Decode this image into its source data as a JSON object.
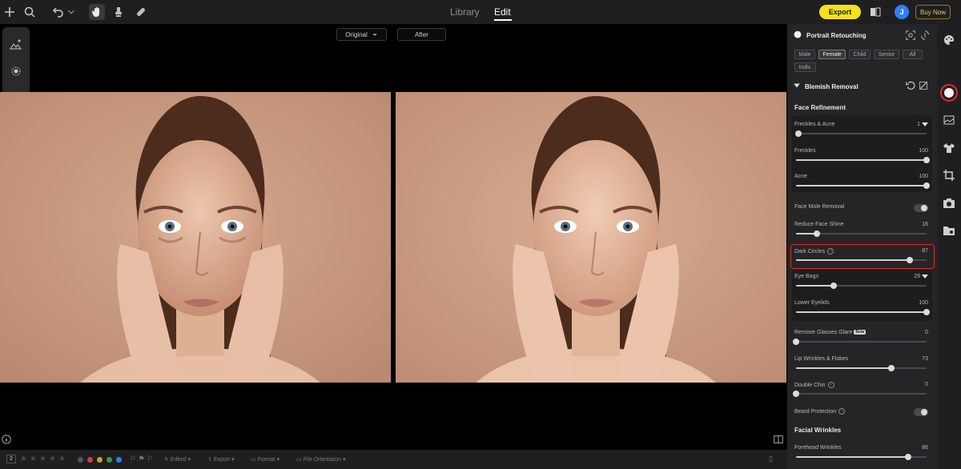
{
  "topbar": {
    "tabs": [
      "Library",
      "Edit"
    ],
    "active_tab": "Edit",
    "export_label": "Export",
    "user_initial": "J",
    "buy_label": "Buy Now"
  },
  "canvas": {
    "compare_mode": "Original",
    "after_label": "After"
  },
  "bottombar": {
    "rating_count": "2",
    "items": [
      "Edited",
      "Export",
      "Format",
      "File Orientation"
    ],
    "color_labels": [
      "#555559",
      "#d33b3b",
      "#c9a227",
      "#3a9a4a",
      "#2f7ff0"
    ]
  },
  "panel": {
    "title": "Portrait Retouching",
    "chips": [
      "Male",
      "Female",
      "Child",
      "Senior",
      "All",
      "Indiv."
    ],
    "selected_chip": "Female",
    "section": "Blemish Removal",
    "face_refinement": "Face Refinement",
    "facial_wrinkles": "Facial Wrinkles",
    "sliders": [
      {
        "label": "Freckles & Acne",
        "value": "1",
        "level": 0.02,
        "caret": true,
        "info": false
      },
      {
        "label": "Freckles",
        "value": "100",
        "level": 1.0,
        "caret": false,
        "info": false
      },
      {
        "label": "Acne",
        "value": "100",
        "level": 1.0,
        "caret": false,
        "info": false
      },
      {
        "label": "Reduce Face Shine",
        "value": "16",
        "level": 0.16,
        "caret": false,
        "info": false
      },
      {
        "label": "Dark Circles",
        "value": "87",
        "level": 0.87,
        "caret": false,
        "info": true
      },
      {
        "label": "Eye Bags",
        "value": "29",
        "level": 0.29,
        "caret": true,
        "info": false
      },
      {
        "label": "Lower Eyelids",
        "value": "100",
        "level": 1.0,
        "caret": false,
        "info": false
      },
      {
        "label": "Remove Glasses Glare",
        "value": "0",
        "level": 0.0,
        "caret": false,
        "info": false,
        "beta": "Beta"
      },
      {
        "label": "Lip Wrinkles & Flakes",
        "value": "73",
        "level": 0.73,
        "caret": false,
        "info": false
      },
      {
        "label": "Double Chin",
        "value": "0",
        "level": 0.0,
        "caret": false,
        "info": true
      },
      {
        "label": "Forehead Wrinkles",
        "value": "86",
        "level": 0.86,
        "caret": false,
        "info": false
      }
    ],
    "toggles": [
      {
        "label": "Face Mole Removal",
        "on": false,
        "info": false
      },
      {
        "label": "Beard Protection",
        "on": false,
        "info": true
      }
    ]
  },
  "colors": {
    "accent_yellow": "#f5e21a",
    "highlight_red": "#e02a2a",
    "avatar_blue": "#2f7ff0"
  }
}
